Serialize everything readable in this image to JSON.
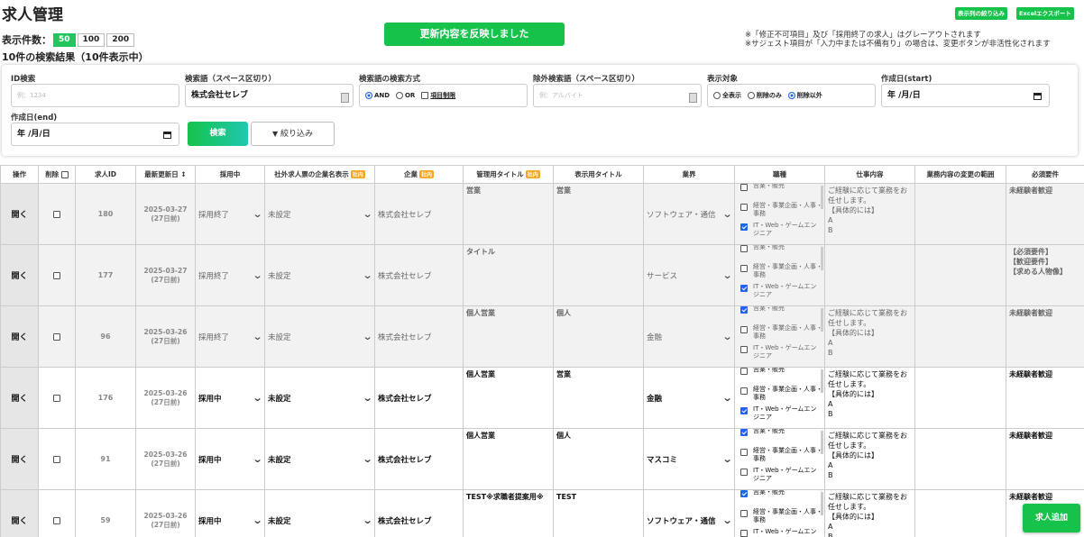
{
  "page": {
    "title": "求人管理"
  },
  "display_count": {
    "label": "表示件数：",
    "options": [
      "50",
      "100",
      "200"
    ],
    "selected": "50"
  },
  "result_text": "10件の検索結果（10件表示中）",
  "toast": "更新内容を反映しました",
  "notes": [
    "※「修正不可項目」及び「採用終了の求人」はグレーアウトされます",
    "※サジェスト項目が「入力中または不備有り」の場合は、変更ボタンが非活性化されます"
  ],
  "top_buttons": {
    "filter_columns": "表示列の絞り込み",
    "excel_export": "Excelエクスポート"
  },
  "search": {
    "id_label": "ID検索",
    "id_placeholder": "例：1234",
    "keyword_label": "検索語（スペース区切り）",
    "keyword_value": "株式会社セレブ",
    "method_label": "検索語の検索方式",
    "method_and": "AND",
    "method_or": "OR",
    "method_item": "項目制限",
    "exclude_label": "除外検索語（スペース区切り）",
    "exclude_placeholder": "例：アルバイト",
    "target_label": "表示対象",
    "target_all": "全表示",
    "target_deleted": "削除のみ",
    "target_not_deleted": "削除以外",
    "start_label": "作成日(start)",
    "start_value": "年 /月/日",
    "end_label": "作成日(end)",
    "end_value": "年 /月/日",
    "search_btn": "検索",
    "filter_btn": "絞り込み"
  },
  "table": {
    "headers": {
      "op": "操作",
      "delete": "削除",
      "id": "求人ID",
      "updated": "最新更新日 ↕",
      "hiring": "採用中",
      "external_company": "社外求人票の企業名表示",
      "company": "企業",
      "admin_title": "管理用タイトル",
      "display_title": "表示用タイトル",
      "industry": "業界",
      "job_type": "職種",
      "work": "仕事内容",
      "change_scope": "業務内容の変更の範囲",
      "requirements": "必須要件"
    },
    "tag_internal": "社内",
    "open_label": "開く",
    "job_options": [
      "営業・販売",
      "経営・事業企画・人事・事務",
      "IT・Web・ゲームエンジニア"
    ],
    "rows": [
      {
        "id": "180",
        "date": "2025-03-27",
        "ago": "(27日前)",
        "status": "採用終了",
        "ext": "未設定",
        "company": "株式会社セレブ",
        "admin_title": "営業",
        "display_title": "営業",
        "industry": "ソフトウェア・通信",
        "jobs": [
          false,
          false,
          true
        ],
        "work": "ご経験に応じて業務をお任せします。\n【具体的には】\nA\nB",
        "req": "未経験者歓迎",
        "grey": true
      },
      {
        "id": "177",
        "date": "2025-03-27",
        "ago": "(27日前)",
        "status": "採用終了",
        "ext": "未設定",
        "company": "株式会社セレブ",
        "admin_title": "タイトル",
        "display_title": "",
        "industry": "サービス",
        "jobs": [
          false,
          false,
          true
        ],
        "work": "",
        "req": "【必須要件】\n【歓迎要件】\n【求める人物像】",
        "grey": true
      },
      {
        "id": "96",
        "date": "2025-03-26",
        "ago": "(27日前)",
        "status": "採用終了",
        "ext": "未設定",
        "company": "株式会社セレブ",
        "admin_title": "個人営業",
        "display_title": "個人",
        "industry": "金融",
        "jobs": [
          true,
          false,
          false
        ],
        "work": "ご経験に応じて業務をお任せします。\n【具体的には】\nA\nB",
        "req": "未経験者歓迎",
        "grey": true
      },
      {
        "id": "176",
        "date": "2025-03-26",
        "ago": "(27日前)",
        "status": "採用中",
        "ext": "未設定",
        "company": "株式会社セレブ",
        "admin_title": "個人営業",
        "display_title": "営業",
        "industry": "金融",
        "jobs": [
          false,
          false,
          true
        ],
        "work": "ご経験に応じて業務をお任せします。\n【具体的には】\nA\nB",
        "req": "未経験者歓迎",
        "grey": false
      },
      {
        "id": "91",
        "date": "2025-03-26",
        "ago": "(27日前)",
        "status": "採用中",
        "ext": "未設定",
        "company": "株式会社セレブ",
        "admin_title": "個人営業",
        "display_title": "個人",
        "industry": "マスコミ",
        "jobs": [
          true,
          false,
          false
        ],
        "work": "ご経験に応じて業務をお任せします。\n【具体的には】\nA\nB",
        "req": "未経験者歓迎",
        "grey": false
      },
      {
        "id": "59",
        "date": "2025-03-26",
        "ago": "(27日前)",
        "status": "採用中",
        "ext": "未設定",
        "company": "株式会社セレブ",
        "admin_title": "TEST※求職者提案用※",
        "display_title": "TEST",
        "industry": "ソフトウェア・通信",
        "jobs": [
          true,
          false,
          false
        ],
        "work": "ご経験に応じて業務をお任せします。\n【具体的には】\nA\nB",
        "req": "未経験者歓迎",
        "grey": false
      }
    ]
  },
  "add_button": "求人追加",
  "colors": {
    "accent": "#16c24a",
    "tag": "#f5a623",
    "check": "#2563eb"
  }
}
